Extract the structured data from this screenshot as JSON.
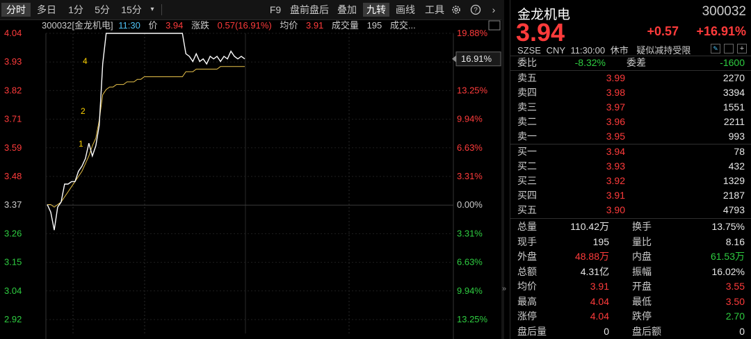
{
  "toolbar": {
    "left": [
      "分时",
      "多日",
      "1分",
      "5分",
      "15分"
    ],
    "right": [
      "F9",
      "盘前盘后",
      "叠加",
      "九转",
      "画线",
      "工具"
    ]
  },
  "info": {
    "code_name": "300032[金龙机电]",
    "time": "11:30",
    "price_label": "价",
    "price": "3.94",
    "change_label": "涨跌",
    "change": "0.57(16.91%)",
    "avg_label": "均价",
    "avg": "3.91",
    "vol_label": "成交量",
    "vol": "195",
    "extra": "成交..."
  },
  "chart_data": {
    "type": "line",
    "title": "",
    "prev_close": 3.37,
    "y_ticks": [
      "4.04",
      "3.93",
      "3.82",
      "3.71",
      "3.59",
      "3.48",
      "3.37",
      "3.26",
      "3.15",
      "3.04",
      "2.92"
    ],
    "pct_ticks": [
      "19.88%",
      "16.91%",
      "13.25%",
      "9.94%",
      "6.63%",
      "3.31%",
      "0.00%",
      "3.31%",
      "6.63%",
      "9.94%",
      "13.25%"
    ],
    "current_pct_tag": "16.91%",
    "markers": [
      "4",
      "2",
      "1"
    ],
    "series": [
      {
        "values": [
          3.37,
          3.34,
          3.27,
          3.36,
          3.38,
          3.45,
          3.45,
          3.46,
          3.46,
          3.5,
          3.52,
          3.55,
          3.61,
          3.56,
          3.6,
          3.68,
          3.92,
          4.04,
          4.04,
          4.04,
          4.04,
          4.04,
          4.04,
          4.04,
          4.04,
          4.04,
          4.04,
          4.04,
          4.04,
          4.04,
          4.04,
          4.04,
          4.04,
          4.04,
          4.04,
          4.04,
          4.04,
          4.04,
          4.04,
          4.04,
          3.96,
          3.95,
          3.93,
          3.96,
          3.93,
          3.94,
          3.92,
          3.95,
          3.94,
          3.95,
          3.93,
          3.95,
          3.94,
          3.97,
          3.95,
          3.94,
          3.95,
          3.94
        ]
      },
      {
        "values": [
          3.37,
          3.37,
          3.36,
          3.37,
          3.38,
          3.4,
          3.42,
          3.44,
          3.46,
          3.48,
          3.5,
          3.53,
          3.56,
          3.6,
          3.63,
          3.7,
          3.8,
          3.82,
          3.83,
          3.83,
          3.84,
          3.84,
          3.84,
          3.85,
          3.85,
          3.85,
          3.86,
          3.86,
          3.87,
          3.87,
          3.87,
          3.87,
          3.87,
          3.87,
          3.87,
          3.87,
          3.87,
          3.87,
          3.87,
          3.87,
          3.89,
          3.89,
          3.89,
          3.9,
          3.9,
          3.9,
          3.9,
          3.9,
          3.9,
          3.9,
          3.91,
          3.91,
          3.91,
          3.91,
          3.91,
          3.91,
          3.91,
          3.91
        ]
      }
    ]
  },
  "quote": {
    "name": "金龙机电",
    "code": "300032",
    "price": "3.94",
    "change": "+0.57",
    "change_pct": "+16.91%",
    "market": "SZSE",
    "currency": "CNY",
    "time": "11:30:00",
    "status": "休市",
    "note": "疑似减持受限",
    "wb_label": "委比",
    "wb_value": "-8.32%",
    "wc_label": "委差",
    "wc_value": "-1600",
    "asks": [
      {
        "label": "卖五",
        "price": "3.99",
        "vol": "2270"
      },
      {
        "label": "卖四",
        "price": "3.98",
        "vol": "3394"
      },
      {
        "label": "卖三",
        "price": "3.97",
        "vol": "1551"
      },
      {
        "label": "卖二",
        "price": "3.96",
        "vol": "2211"
      },
      {
        "label": "卖一",
        "price": "3.95",
        "vol": "993"
      }
    ],
    "bids": [
      {
        "label": "买一",
        "price": "3.94",
        "vol": "78"
      },
      {
        "label": "买二",
        "price": "3.93",
        "vol": "432"
      },
      {
        "label": "买三",
        "price": "3.92",
        "vol": "1329"
      },
      {
        "label": "买四",
        "price": "3.91",
        "vol": "2187"
      },
      {
        "label": "买五",
        "price": "3.90",
        "vol": "4793"
      }
    ],
    "stats": [
      {
        "l1": "总量",
        "v1": "110.42万",
        "l2": "换手",
        "v2": "13.75%"
      },
      {
        "l1": "现手",
        "v1": "195",
        "l2": "量比",
        "v2": "8.16"
      },
      {
        "l1": "外盘",
        "v1": "48.88万",
        "l2": "内盘",
        "v2": "61.53万"
      },
      {
        "l1": "总额",
        "v1": "4.31亿",
        "l2": "振幅",
        "v2": "16.02%"
      },
      {
        "l1": "均价",
        "v1": "3.91",
        "l2": "开盘",
        "v2": "3.55"
      },
      {
        "l1": "最高",
        "v1": "4.04",
        "l2": "最低",
        "v2": "3.50"
      },
      {
        "l1": "涨停",
        "v1": "4.04",
        "l2": "跌停",
        "v2": "2.70"
      },
      {
        "l1": "盘后量",
        "v1": "0",
        "l2": "盘后额",
        "v2": "0"
      }
    ]
  },
  "colors": {
    "up": "#ff3b3b",
    "down": "#2ecc40",
    "price_line": "#ffffff",
    "avg_line": "#e8c24a"
  }
}
